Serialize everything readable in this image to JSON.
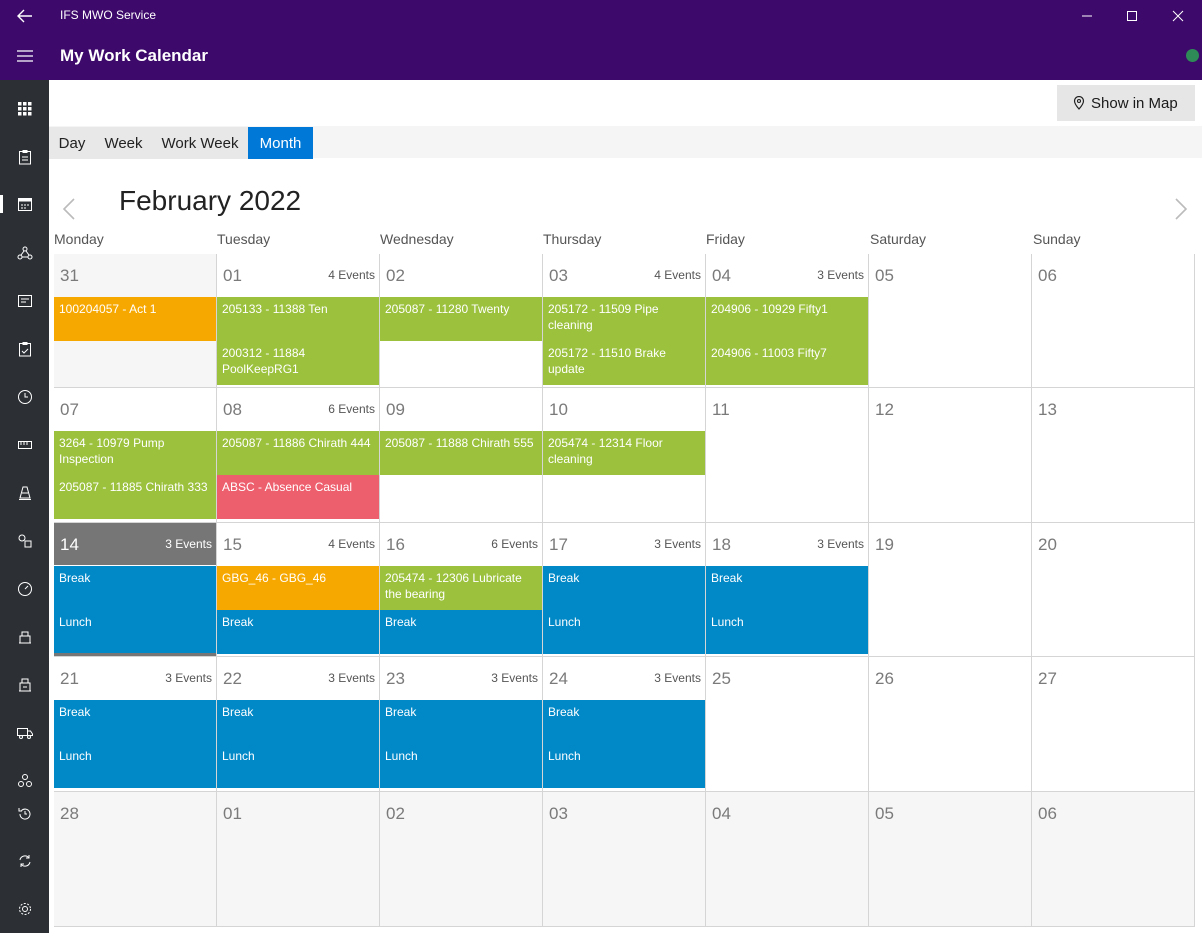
{
  "window": {
    "app_title": "IFS MWO Service"
  },
  "header": {
    "page_title": "My Work Calendar"
  },
  "colors": {
    "titlebar": "#3d0a6b",
    "sidebar": "#2c3035",
    "accent": "#0078d7",
    "orange": "#f7a800",
    "green": "#9bc13d",
    "red": "#ee5f6e",
    "blue": "#0088c7",
    "today": "#767676"
  },
  "sidebar": {
    "items": [
      {
        "icon": "grid-icon"
      },
      {
        "icon": "clipboard-icon"
      },
      {
        "icon": "calendar-icon",
        "active": true
      },
      {
        "icon": "network-icon"
      },
      {
        "icon": "form-icon"
      },
      {
        "icon": "checklist-icon"
      },
      {
        "icon": "clock-icon"
      },
      {
        "icon": "ruler-icon"
      },
      {
        "icon": "cone-icon"
      },
      {
        "icon": "parts-icon"
      },
      {
        "icon": "gauge-icon"
      },
      {
        "icon": "building-icon"
      },
      {
        "icon": "factory-icon"
      },
      {
        "icon": "truck-icon"
      },
      {
        "icon": "boxes-icon"
      },
      {
        "icon": "history-icon"
      },
      {
        "icon": "sync-icon"
      },
      {
        "icon": "settings-icon"
      }
    ]
  },
  "toolbar": {
    "show_in_map": "Show in Map"
  },
  "views": {
    "tabs": [
      "Day",
      "Week",
      "Work Week",
      "Month"
    ],
    "active": "Month"
  },
  "calendar": {
    "month_title": "February 2022",
    "weekdays": [
      "Monday",
      "Tuesday",
      "Wednesday",
      "Thursday",
      "Friday",
      "Saturday",
      "Sunday"
    ],
    "weeks": [
      [
        {
          "day": "31",
          "other": true,
          "events": [
            {
              "text": "100204057 - Act 1",
              "color": "orange"
            }
          ]
        },
        {
          "day": "01",
          "count": "4 Events",
          "events": [
            {
              "text": "205133 - 11388 Ten",
              "color": "green"
            },
            {
              "text": "200312 - 11884 PoolKeepRG1",
              "color": "green"
            }
          ]
        },
        {
          "day": "02",
          "events": [
            {
              "text": "205087 - 11280 Twenty",
              "color": "green"
            }
          ]
        },
        {
          "day": "03",
          "count": "4 Events",
          "events": [
            {
              "text": "205172 - 11509 Pipe cleaning",
              "color": "green"
            },
            {
              "text": "205172 - 11510 Brake update",
              "color": "green"
            }
          ]
        },
        {
          "day": "04",
          "count": "3 Events",
          "events": [
            {
              "text": "204906 - 10929 Fifty1",
              "color": "green"
            },
            {
              "text": "204906 - 11003 Fifty7",
              "color": "green"
            }
          ]
        },
        {
          "day": "05",
          "events": []
        },
        {
          "day": "06",
          "events": []
        }
      ],
      [
        {
          "day": "07",
          "events": [
            {
              "text": "3264 - 10979 Pump Inspection",
              "color": "green"
            },
            {
              "text": "205087 - 11885 Chirath 333",
              "color": "green"
            }
          ]
        },
        {
          "day": "08",
          "count": "6 Events",
          "events": [
            {
              "text": "205087 - 11886 Chirath 444",
              "color": "green"
            },
            {
              "text": "ABSC - Absence Casual",
              "color": "red"
            }
          ]
        },
        {
          "day": "09",
          "events": [
            {
              "text": "205087 - 11888 Chirath 555",
              "color": "green"
            }
          ]
        },
        {
          "day": "10",
          "events": [
            {
              "text": "205474 - 12314 Floor cleaning",
              "color": "green"
            }
          ]
        },
        {
          "day": "11",
          "events": []
        },
        {
          "day": "12",
          "events": []
        },
        {
          "day": "13",
          "events": []
        }
      ],
      [
        {
          "day": "14",
          "today": true,
          "count": "3 Events",
          "events": [
            {
              "text": "Break",
              "color": "blue"
            },
            {
              "text": "Lunch",
              "color": "blue"
            }
          ]
        },
        {
          "day": "15",
          "count": "4 Events",
          "events": [
            {
              "text": "GBG_46 - GBG_46",
              "color": "orange"
            },
            {
              "text": "Break",
              "color": "blue"
            }
          ]
        },
        {
          "day": "16",
          "count": "6 Events",
          "events": [
            {
              "text": "205474 - 12306 Lubricate the bearing",
              "color": "green"
            },
            {
              "text": "Break",
              "color": "blue"
            }
          ]
        },
        {
          "day": "17",
          "count": "3 Events",
          "events": [
            {
              "text": "Break",
              "color": "blue"
            },
            {
              "text": "Lunch",
              "color": "blue"
            }
          ]
        },
        {
          "day": "18",
          "count": "3 Events",
          "events": [
            {
              "text": "Break",
              "color": "blue"
            },
            {
              "text": "Lunch",
              "color": "blue"
            }
          ]
        },
        {
          "day": "19",
          "events": []
        },
        {
          "day": "20",
          "events": []
        }
      ],
      [
        {
          "day": "21",
          "count": "3 Events",
          "events": [
            {
              "text": "Break",
              "color": "blue"
            },
            {
              "text": "Lunch",
              "color": "blue"
            }
          ]
        },
        {
          "day": "22",
          "count": "3 Events",
          "events": [
            {
              "text": "Break",
              "color": "blue"
            },
            {
              "text": "Lunch",
              "color": "blue"
            }
          ]
        },
        {
          "day": "23",
          "count": "3 Events",
          "events": [
            {
              "text": "Break",
              "color": "blue"
            },
            {
              "text": "Lunch",
              "color": "blue"
            }
          ]
        },
        {
          "day": "24",
          "count": "3 Events",
          "events": [
            {
              "text": "Break",
              "color": "blue"
            },
            {
              "text": "Lunch",
              "color": "blue"
            }
          ]
        },
        {
          "day": "25",
          "events": []
        },
        {
          "day": "26",
          "events": []
        },
        {
          "day": "27",
          "events": []
        }
      ],
      [
        {
          "day": "28",
          "other": true,
          "events": []
        },
        {
          "day": "01",
          "other": true,
          "events": []
        },
        {
          "day": "02",
          "other": true,
          "events": []
        },
        {
          "day": "03",
          "other": true,
          "events": []
        },
        {
          "day": "04",
          "other": true,
          "events": []
        },
        {
          "day": "05",
          "other": true,
          "events": []
        },
        {
          "day": "06",
          "other": true,
          "events": []
        }
      ]
    ]
  }
}
